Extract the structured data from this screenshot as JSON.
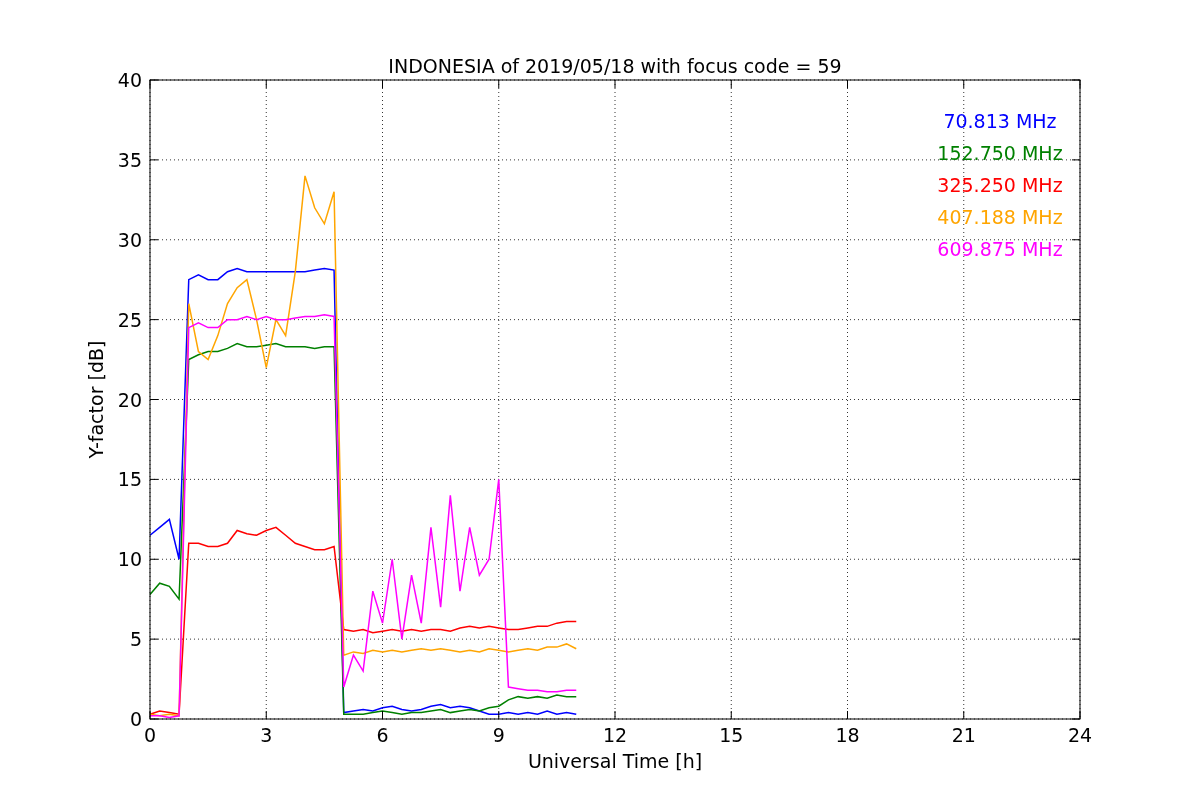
{
  "chart_data": {
    "type": "line",
    "title": "INDONESIA of 2019/05/18 with focus code = 59",
    "xlabel": "Universal Time [h]",
    "ylabel": "Y-factor [dB]",
    "xlim": [
      0,
      24
    ],
    "ylim": [
      0,
      40
    ],
    "xticks": [
      0,
      3,
      6,
      9,
      12,
      15,
      18,
      21,
      24
    ],
    "yticks": [
      0,
      5,
      10,
      15,
      20,
      25,
      30,
      35,
      40
    ],
    "grid": true,
    "x": [
      0,
      0.25,
      0.5,
      0.75,
      1,
      1.25,
      1.5,
      1.75,
      2,
      2.25,
      2.5,
      2.75,
      3,
      3.25,
      3.5,
      3.75,
      4,
      4.25,
      4.5,
      4.75,
      5,
      5.25,
      5.5,
      5.75,
      6,
      6.25,
      6.5,
      6.75,
      7,
      7.25,
      7.5,
      7.75,
      8,
      8.25,
      8.5,
      8.75,
      9,
      9.25,
      9.5,
      9.75,
      10,
      10.25,
      10.5,
      10.75,
      11
    ],
    "series": [
      {
        "name": "70.813 MHz",
        "color": "#0000ff",
        "values": [
          11.5,
          12,
          12.5,
          10,
          27.5,
          27.8,
          27.5,
          27.5,
          28,
          28.2,
          28,
          28,
          28,
          28,
          28,
          28,
          28,
          28.1,
          28.2,
          28.1,
          0.4,
          0.5,
          0.6,
          0.5,
          0.7,
          0.8,
          0.6,
          0.5,
          0.6,
          0.8,
          0.9,
          0.7,
          0.8,
          0.7,
          0.5,
          0.3,
          0.3,
          0.4,
          0.3,
          0.4,
          0.3,
          0.5,
          0.3,
          0.4,
          0.3
        ]
      },
      {
        "name": "152.750 MHz",
        "color": "#008000",
        "values": [
          7.8,
          8.5,
          8.3,
          7.5,
          22.5,
          22.8,
          23,
          23,
          23.2,
          23.5,
          23.3,
          23.3,
          23.4,
          23.5,
          23.3,
          23.3,
          23.3,
          23.2,
          23.3,
          23.3,
          0.3,
          0.3,
          0.3,
          0.4,
          0.5,
          0.4,
          0.3,
          0.4,
          0.4,
          0.5,
          0.6,
          0.4,
          0.5,
          0.6,
          0.5,
          0.7,
          0.8,
          1.2,
          1.4,
          1.3,
          1.4,
          1.3,
          1.5,
          1.4,
          1.4
        ]
      },
      {
        "name": "325.250 MHz",
        "color": "#ff0000",
        "values": [
          0.3,
          0.5,
          0.4,
          0.3,
          11,
          11,
          10.8,
          10.8,
          11,
          11.8,
          11.6,
          11.5,
          11.8,
          12,
          11.5,
          11,
          10.8,
          10.6,
          10.6,
          10.8,
          5.6,
          5.5,
          5.6,
          5.4,
          5.5,
          5.6,
          5.5,
          5.6,
          5.5,
          5.6,
          5.6,
          5.5,
          5.7,
          5.8,
          5.7,
          5.8,
          5.7,
          5.6,
          5.6,
          5.7,
          5.8,
          5.8,
          6,
          6.1,
          6.1
        ]
      },
      {
        "name": "407.188 MHz",
        "color": "#ffa500",
        "values": [
          0.3,
          0.2,
          0.3,
          0.2,
          26,
          23,
          22.5,
          24,
          26,
          27,
          27.5,
          25,
          22,
          25,
          24,
          28,
          34,
          32,
          31,
          33,
          4,
          4.2,
          4.1,
          4.3,
          4.2,
          4.3,
          4.2,
          4.3,
          4.4,
          4.3,
          4.4,
          4.3,
          4.2,
          4.3,
          4.2,
          4.4,
          4.3,
          4.2,
          4.3,
          4.4,
          4.3,
          4.5,
          4.5,
          4.7,
          4.4
        ]
      },
      {
        "name": "609.875 MHz",
        "color": "#ff00ff",
        "values": [
          0.2,
          0.2,
          0.1,
          0.2,
          24.5,
          24.8,
          24.5,
          24.5,
          25,
          25,
          25.2,
          25,
          25.2,
          25,
          25,
          25.1,
          25.2,
          25.2,
          25.3,
          25.2,
          2,
          4,
          3,
          8,
          6,
          10,
          5,
          9,
          6,
          12,
          7,
          14,
          8,
          12,
          9,
          10,
          15,
          2,
          1.9,
          1.8,
          1.8,
          1.7,
          1.7,
          1.8,
          1.8
        ]
      }
    ]
  }
}
